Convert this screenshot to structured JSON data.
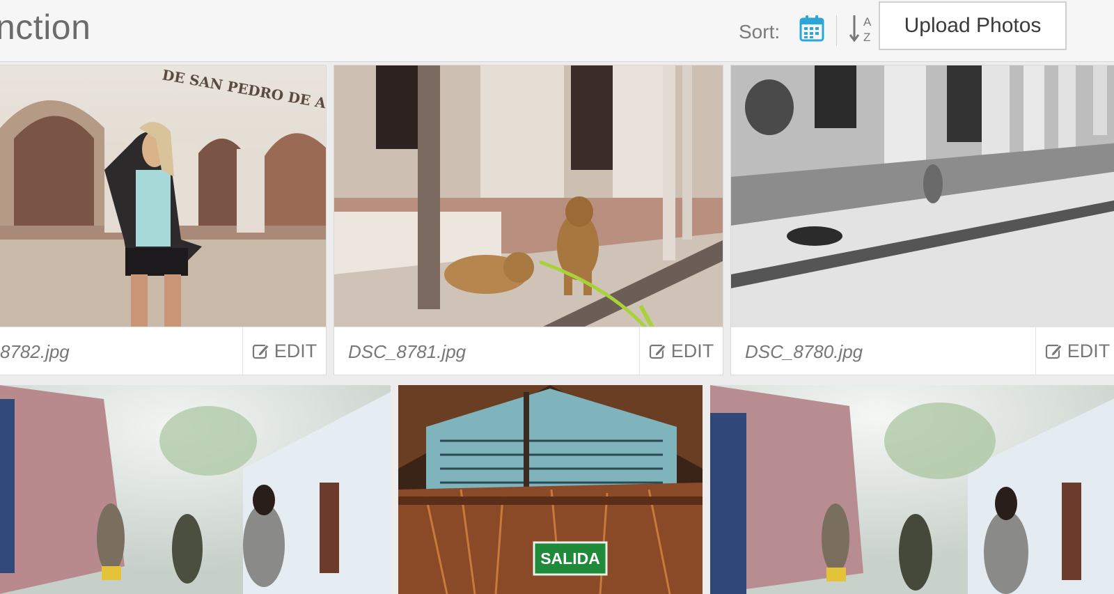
{
  "header": {
    "title": "nction",
    "sort_label": "Sort:",
    "upload_label": "Upload Photos",
    "accent_color": "#2aa7d8"
  },
  "icons": {
    "sort_by_date": "calendar-icon",
    "sort_alpha": "sort-alpha-az-icon",
    "edit": "edit-pencil-icon"
  },
  "photos": [
    {
      "filename": "8782.jpg",
      "edit_label": "EDIT"
    },
    {
      "filename": "DSC_8781.jpg",
      "edit_label": "EDIT"
    },
    {
      "filename": "DSC_8780.jpg",
      "edit_label": "EDIT"
    },
    {
      "sign_text": "SALIDA"
    }
  ],
  "photo_captions": {
    "building_sign": "DE SAN PEDRO DE ATAC"
  }
}
